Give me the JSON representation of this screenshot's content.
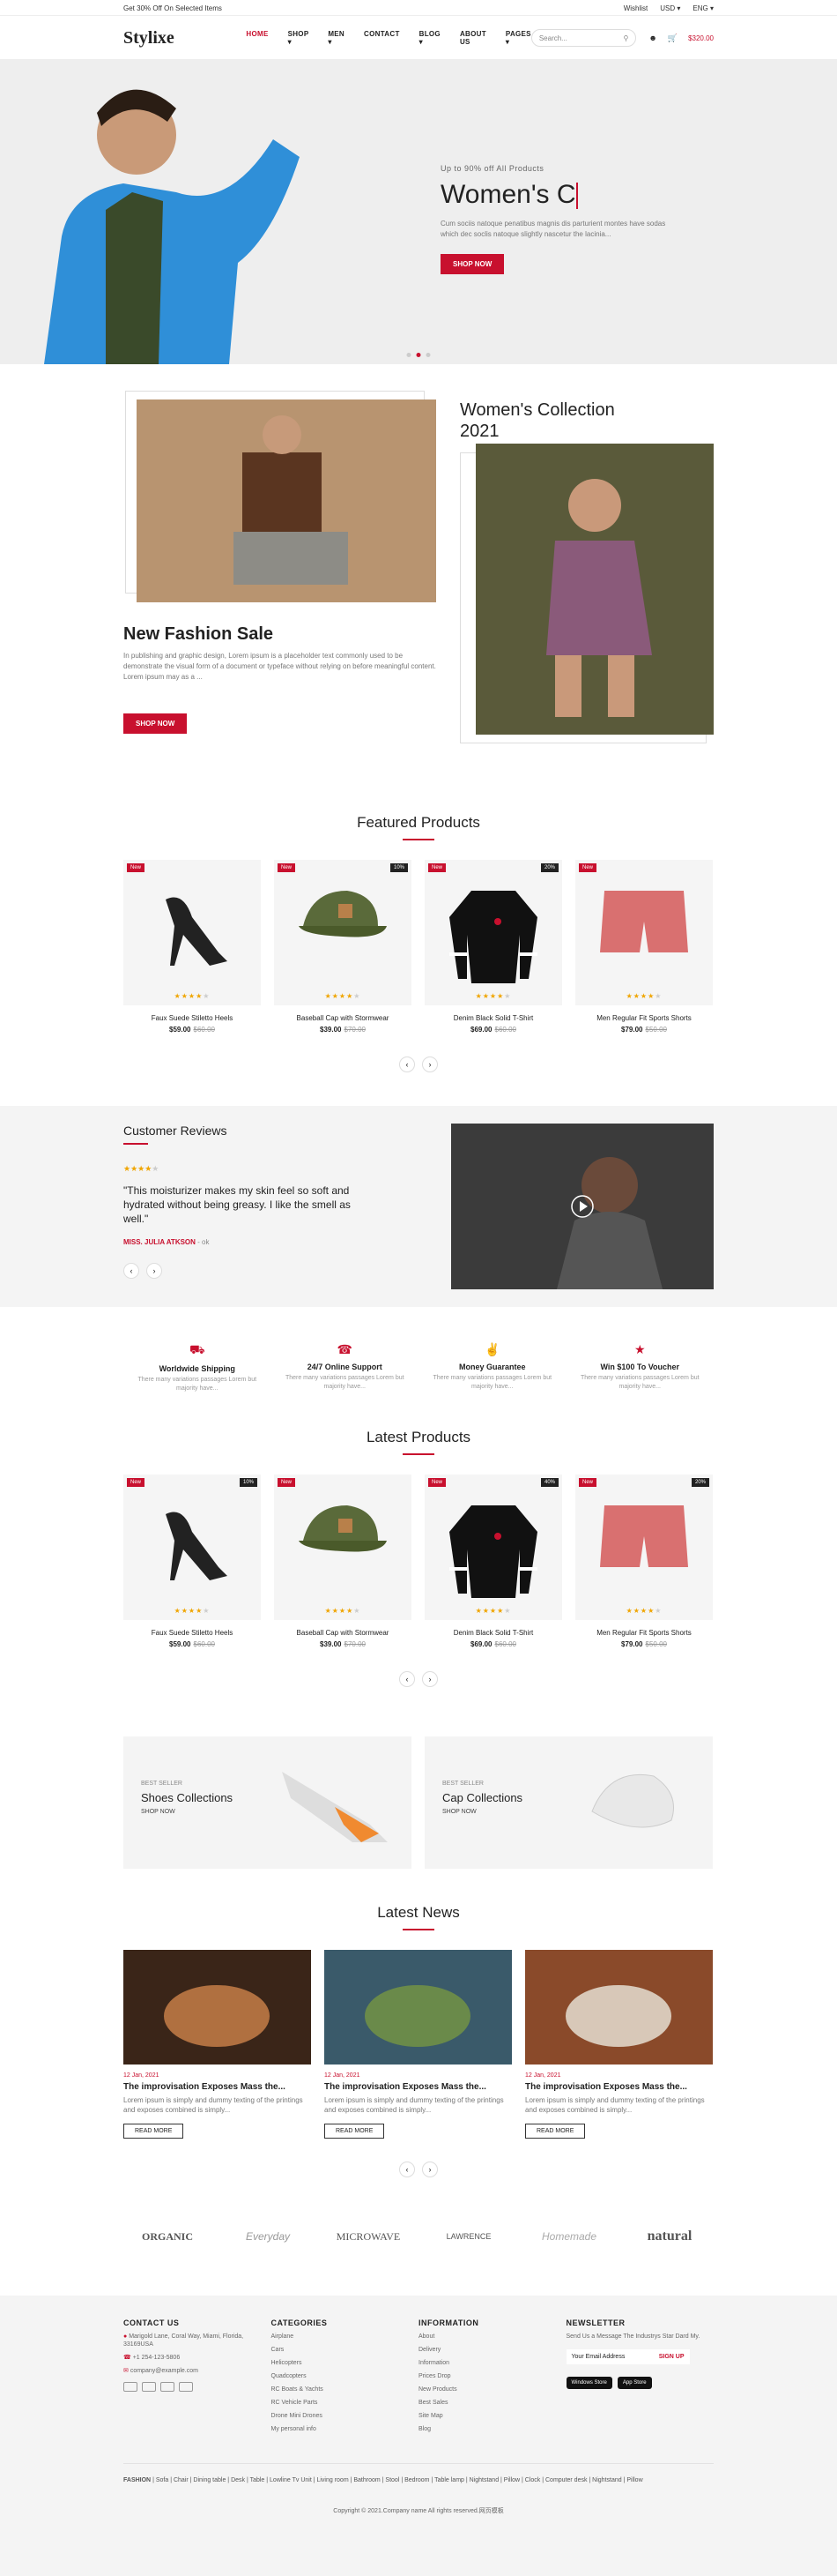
{
  "topbar": {
    "promo": "Get 30% Off On Selected Items",
    "wishlist": "Wishlist",
    "currency": "USD",
    "language": "ENG"
  },
  "header": {
    "logo": "Stylixe",
    "nav": [
      "HOME",
      "SHOP",
      "MEN",
      "CONTACT",
      "BLOG",
      "ABOUT US",
      "PAGES"
    ],
    "search_placeholder": "Search...",
    "cart_price": "$320.00"
  },
  "hero": {
    "kicker": "Up to 90% off All Products",
    "title": "Women's C",
    "description": "Cum sociis natoque penatibus magnis dis parturient montes have sodas which dec soclis natoque slightly nascetur the lacinia...",
    "button": "SHOP NOW"
  },
  "collections": {
    "women_title": "Women's Collection 2021",
    "sale_title": "New Fashion Sale",
    "sale_desc": "In publishing and graphic design, Lorem ipsum is a placeholder text commonly used to be demonstrate the visual form of a document or typeface without relying on before meaningful content. Lorem ipsum may as a ...",
    "sale_button": "SHOP NOW"
  },
  "featured": {
    "title": "Featured Products",
    "items": [
      {
        "badge": "New",
        "discount": "",
        "name": "Faux Suede Stiletto Heels",
        "price": "$59.00",
        "old": "$60.00",
        "stars": 4
      },
      {
        "badge": "New",
        "discount": "10%",
        "name": "Baseball Cap with Stormwear",
        "price": "$39.00",
        "old": "$70.00",
        "stars": 4
      },
      {
        "badge": "New",
        "discount": "20%",
        "name": "Denim Black Solid T-Shirt",
        "price": "$69.00",
        "old": "$60.00",
        "stars": 4
      },
      {
        "badge": "New",
        "discount": "",
        "name": "Men Regular Fit Sports Shorts",
        "price": "$79.00",
        "old": "$50.00",
        "stars": 4
      }
    ]
  },
  "reviews": {
    "title": "Customer Reviews",
    "quote": "\"This moisturizer makes my skin feel so soft and hydrated without being greasy. I like the smell as well.\"",
    "author": "MISS. JULIA ATKSON",
    "role": "- ok"
  },
  "features": [
    {
      "title": "Worldwide Shipping",
      "desc": "There many variations passages Lorem but majority have..."
    },
    {
      "title": "24/7 Online Support",
      "desc": "There many variations passages Lorem but majority have..."
    },
    {
      "title": "Money Guarantee",
      "desc": "There many variations passages Lorem but majority have..."
    },
    {
      "title": "Win $100 To Voucher",
      "desc": "There many variations passages Lorem but majority have..."
    }
  ],
  "latest": {
    "title": "Latest Products",
    "items": [
      {
        "badge": "New",
        "discount": "10%",
        "name": "Faux Suede Stiletto Heels",
        "price": "$59.00",
        "old": "$60.00",
        "stars": 4
      },
      {
        "badge": "New",
        "discount": "",
        "name": "Baseball Cap with Stormwear",
        "price": "$39.00",
        "old": "$70.00",
        "stars": 4
      },
      {
        "badge": "New",
        "discount": "40%",
        "name": "Denim Black Solid T-Shirt",
        "price": "$69.00",
        "old": "$60.00",
        "stars": 4
      },
      {
        "badge": "New",
        "discount": "20%",
        "name": "Men Regular Fit Sports Shorts",
        "price": "$79.00",
        "old": "$50.00",
        "stars": 4
      }
    ]
  },
  "banners": [
    {
      "kicker": "BEST SELLER",
      "title": "Shoes Collections",
      "link": "SHOP NOW"
    },
    {
      "kicker": "BEST SELLER",
      "title": "Cap Collections",
      "link": "SHOP NOW"
    }
  ],
  "news": {
    "title": "Latest News",
    "items": [
      {
        "date": "12 Jan, 2021",
        "title": "The improvisation Exposes Mass the...",
        "desc": "Lorem ipsum is simply and dummy texting of the printings and exposes combined is simply...",
        "button": "READ MORE"
      },
      {
        "date": "12 Jan, 2021",
        "title": "The improvisation Exposes Mass the...",
        "desc": "Lorem ipsum is simply and dummy texting of the printings and exposes combined is simply...",
        "button": "READ MORE"
      },
      {
        "date": "12 Jan, 2021",
        "title": "The improvisation Exposes Mass the...",
        "desc": "Lorem ipsum is simply and dummy texting of the printings and exposes combined is simply...",
        "button": "READ MORE"
      }
    ]
  },
  "brands": [
    "ORGANIC",
    "Everyday",
    "MICROWAVE",
    "LAWRENCE",
    "Homemade",
    "natural"
  ],
  "footer": {
    "contact": {
      "title": "CONTACT US",
      "address": "Marigold Lane, Coral Way, Miami, Florida, 33169USA",
      "phone": "+1 254-123-5806",
      "email": "company@example.com"
    },
    "categories": {
      "title": "CATEGORIES",
      "items": [
        "Airplane",
        "Cars",
        "Helicopters",
        "Quadcopters",
        "RC Boats & Yachts",
        "RC Vehicle Parts",
        "Drone Mini Drones",
        "My personal info"
      ]
    },
    "information": {
      "title": "INFORMATION",
      "items": [
        "About",
        "Delivery",
        "Information",
        "Prices Drop",
        "New Products",
        "Best Sales",
        "Site Map",
        "Blog"
      ]
    },
    "newsletter": {
      "title": "NEWSLETTER",
      "desc": "Send Us a Message The Industrys Star Dard My.",
      "placeholder": "Your Email Address",
      "button": "SIGN UP",
      "app1": "Windows Store",
      "app2": "App Store"
    },
    "tags_label": "FASHION",
    "tags": "Sofa | Chair | Dining table | Desk | Table | Lowline Tv Unit | Living room | Bathroom | Stool | Bedroom | Table lamp | Nightstand | Pillow | Clock | Computer desk | Nightstand | Pillow",
    "copyright": "Copyright © 2021.Company name All rights reserved.网页模板"
  }
}
